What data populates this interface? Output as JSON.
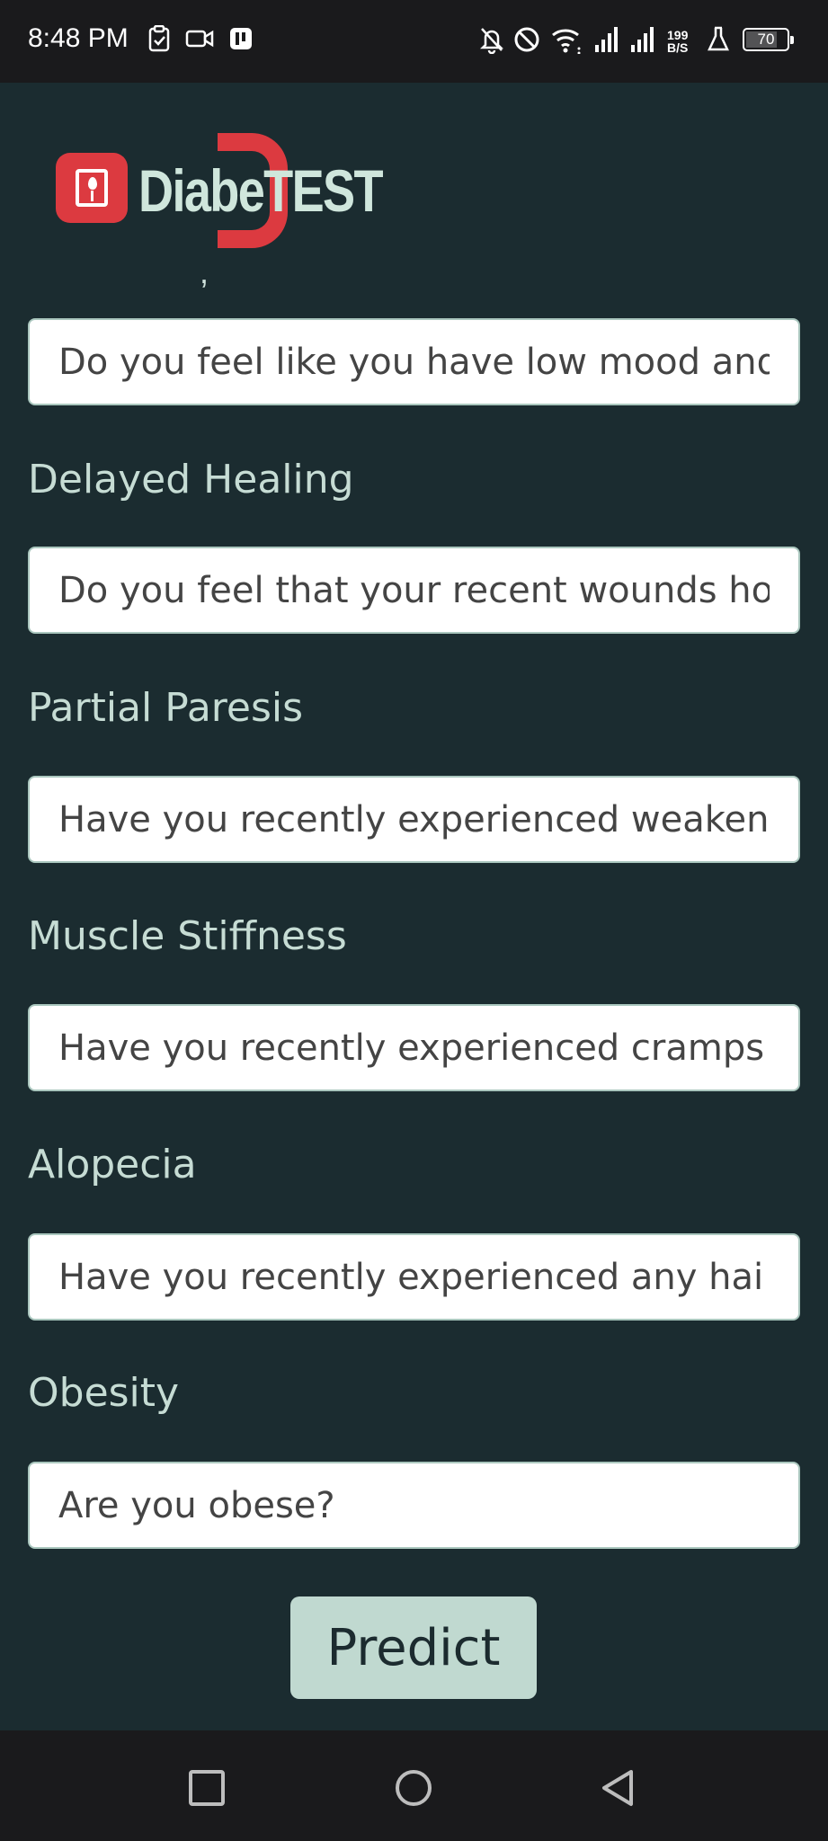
{
  "status_bar": {
    "time": "8:48 PM",
    "net_speed_value": "199",
    "net_speed_unit": "B/S",
    "battery_level": "70",
    "icons": [
      "clipboard-icon",
      "video-camera-icon",
      "app-icon",
      "notifications-off-icon",
      "do-not-disturb-icon",
      "wifi-icon",
      "signal-icon",
      "signal-icon",
      "lab-flask-icon",
      "battery-icon"
    ]
  },
  "header": {
    "logo_text": "DiabeTEST",
    "stray_mark": ","
  },
  "form": {
    "fields": [
      {
        "label": "",
        "placeholder": "Do you feel like you have low mood and"
      },
      {
        "label": "Delayed Healing",
        "placeholder": "Do you feel that your recent wounds ho"
      },
      {
        "label": "Partial Paresis",
        "placeholder": "Have you recently experienced weaken"
      },
      {
        "label": "Muscle Stiffness",
        "placeholder": "Have you recently experienced cramps"
      },
      {
        "label": "Alopecia",
        "placeholder": "Have you recently experienced any hai"
      },
      {
        "label": "Obesity",
        "placeholder": "Are you obese?"
      }
    ],
    "submit_label": "Predict"
  },
  "nav_bar": {
    "buttons": [
      "recents-square-icon",
      "home-circle-icon",
      "back-triangle-icon"
    ]
  },
  "colors": {
    "background": "#1b2c30",
    "label": "#c6dcd4",
    "button": "#c0d9d0",
    "logo_red": "#dc3a40"
  }
}
